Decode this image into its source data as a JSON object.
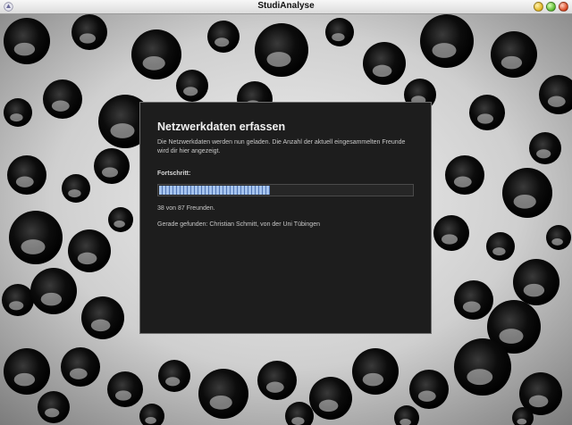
{
  "window": {
    "title": "StudiAnalyse",
    "app_icon": "java-app-icon",
    "controls": [
      "minimize-button",
      "maximize-button",
      "close-button"
    ]
  },
  "background": {
    "description_icon": "water-droplets-image"
  },
  "dialog": {
    "title": "Netzwerkdaten erfassen",
    "description": "Die Netzwerkdaten werden nun geladen. Die Anzahl der aktuell eingesammelten Freunde wird dir hier angezeigt.",
    "progress_label": "Fortschritt:",
    "progress_fraction": 0.437,
    "count_text": "38 von 87 Freunden.",
    "found_text": "Gerade gefunden: Christian Schmitt, von der Uni Tübingen"
  },
  "colors": {
    "dialog_bg": "#1d1d1d",
    "progress_fill": "#a6c4ee",
    "progress_stripe": "#4f74b4"
  }
}
